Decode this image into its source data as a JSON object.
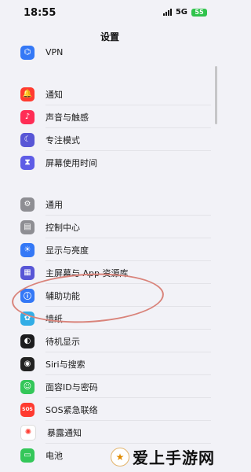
{
  "status_bar": {
    "time": "18:55",
    "network": "5G",
    "battery": "55"
  },
  "header": {
    "title": "设置"
  },
  "top_group": [
    {
      "label": "VPN",
      "icon": "vpn-icon",
      "color": "#3478f6",
      "glyph": "⌬"
    }
  ],
  "group1": [
    {
      "label": "通知",
      "icon": "bell-icon",
      "color": "#ff3b30",
      "glyph": "🔔"
    },
    {
      "label": "声音与触感",
      "icon": "speaker-icon",
      "color": "#ff2d55",
      "glyph": "♪"
    },
    {
      "label": "专注模式",
      "icon": "moon-icon",
      "color": "#5856d6",
      "glyph": "☾"
    },
    {
      "label": "屏幕使用时间",
      "icon": "hourglass-icon",
      "color": "#5e5ce6",
      "glyph": "⧗"
    }
  ],
  "group2": [
    {
      "label": "通用",
      "icon": "gear-icon",
      "color": "#8e8e93",
      "glyph": "⚙"
    },
    {
      "label": "控制中心",
      "icon": "toggles-icon",
      "color": "#8e8e93",
      "glyph": "▤"
    },
    {
      "label": "显示与亮度",
      "icon": "brightness-icon",
      "color": "#3478f6",
      "glyph": "☀"
    },
    {
      "label": "主屏幕与 App 资源库",
      "icon": "home-grid-icon",
      "color": "#5856d6",
      "glyph": "▦"
    },
    {
      "label": "辅助功能",
      "icon": "accessibility-icon",
      "color": "#3478f6",
      "glyph": "ⓘ"
    },
    {
      "label": "墙纸",
      "icon": "wallpaper-icon",
      "color": "#32ade6",
      "glyph": "✿"
    },
    {
      "label": "待机显示",
      "icon": "standby-icon",
      "color": "#1c1c1e",
      "glyph": "◐"
    },
    {
      "label": "Siri与搜索",
      "icon": "siri-icon",
      "color": "#222222",
      "glyph": "◉"
    },
    {
      "label": "面容ID与密码",
      "icon": "faceid-icon",
      "color": "#34c759",
      "glyph": "☺"
    },
    {
      "label": "SOS紧急联络",
      "icon": "sos-icon",
      "color": "#ff3b30",
      "glyph": "SOS"
    },
    {
      "label": "暴露通知",
      "icon": "exposure-icon",
      "color": "#ffffff",
      "glyph": "✺"
    },
    {
      "label": "电池",
      "icon": "battery-icon",
      "color": "#34c759",
      "glyph": "▭"
    }
  ],
  "watermark": {
    "text": "爱上手游网",
    "logo": "★"
  }
}
